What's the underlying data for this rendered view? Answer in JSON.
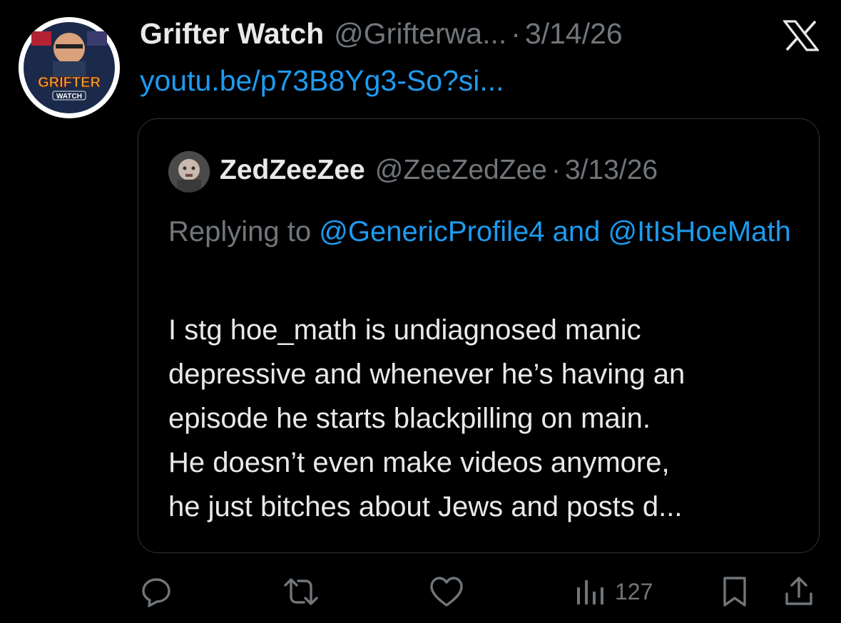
{
  "post": {
    "display_name": "Grifter Watch",
    "handle": "@Grifterwa...",
    "separator": "·",
    "date": "3/14/26",
    "link_text": "youtu.be/p73B8Yg3-So?si...",
    "avatar_text_top": "GRIFTER",
    "avatar_text_bottom": "WATCH"
  },
  "quoted": {
    "display_name": "ZedZeeZee",
    "handle": "@ZeeZedZee",
    "separator": "·",
    "date": "3/13/26",
    "replying_prefix": "Replying to ",
    "replying_mentions": "@GenericProfile4 and @ItIsHoeMath",
    "text_lines": [
      "I stg hoe_math is undiagnosed manic",
      "depressive and whenever he’s having an",
      "episode he starts blackpilling on main.",
      "He doesn’t even make videos anymore,",
      "he just bitches about Jews and posts d..."
    ]
  },
  "actions": {
    "reply_icon": "reply-icon",
    "repost_icon": "repost-icon",
    "like_icon": "heart-icon",
    "views_icon": "views-icon",
    "views_count": "127",
    "bookmark_icon": "bookmark-icon",
    "share_icon": "share-icon"
  },
  "colors": {
    "background": "#000000",
    "text_primary": "#e7e9ea",
    "text_secondary": "#71767b",
    "accent": "#1d9bf0",
    "border": "#2f3336"
  }
}
